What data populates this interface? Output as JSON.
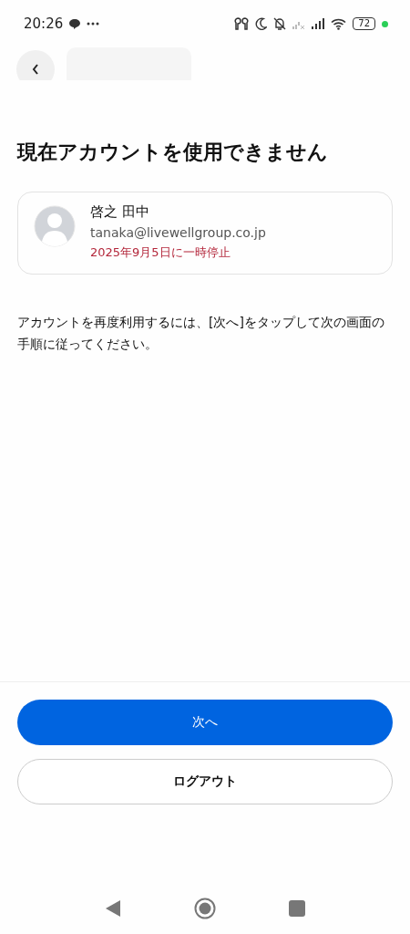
{
  "status_bar": {
    "time": "20:26",
    "battery": "72"
  },
  "title": "現在アカウントを使用できません",
  "account": {
    "name": "啓之 田中",
    "email": "tanaka@livewellgroup.co.jp",
    "status": "2025年9月5日に一時停止"
  },
  "message": "アカウントを再度利用するには、[次へ]をタップして次の画面の手順に従ってください。",
  "buttons": [
    {
      "label": "次へ",
      "kind": "primary"
    },
    {
      "label": "ログアウト",
      "kind": "outline"
    }
  ]
}
